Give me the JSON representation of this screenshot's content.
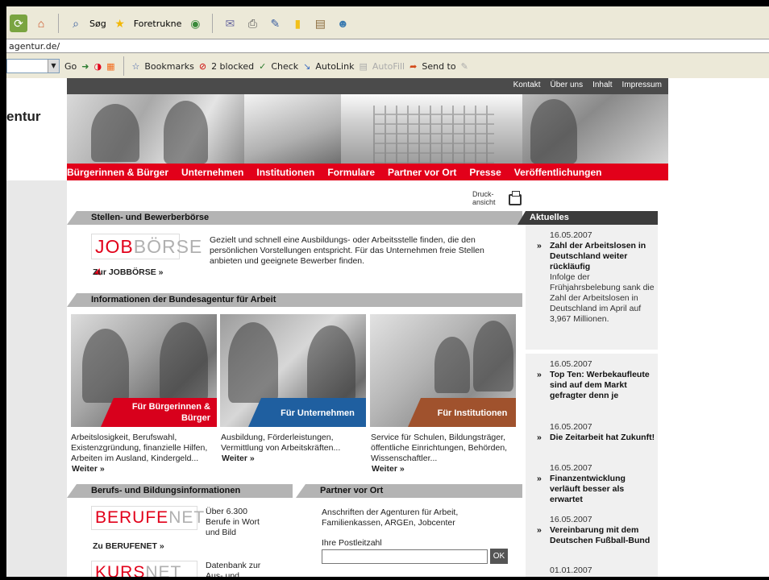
{
  "browser": {
    "toolbar": {
      "search_label": "Søg",
      "favorites_label": "Foretrukne"
    },
    "address": "agentur.de/",
    "google_bar": {
      "go_label": "Go",
      "bookmarks_label": "Bookmarks",
      "blocked_label": "2 blocked",
      "check_label": "Check",
      "autolink_label": "AutoLink",
      "autofill_label": "AutoFill",
      "sendto_label": "Send to"
    }
  },
  "page": {
    "brand_fragment": "entur",
    "topnav": [
      "Kontakt",
      "Über uns",
      "Inhalt",
      "Impressum"
    ],
    "mainnav": [
      "Bürgerinnen & Bürger",
      "Unternehmen",
      "Institutionen",
      "Formulare",
      "Partner vor Ort",
      "Presse",
      "Veröffentlichungen"
    ],
    "druck_line1": "Druck-",
    "druck_line2": "ansicht",
    "stellen": {
      "heading": "Stellen- und Bewerberbörse",
      "logo_red": "JOB",
      "logo_gray": "BÖRSE",
      "text": "Gezielt und schnell eine Ausbildungs- oder Arbeitsstelle finden, die den persönlichen Vorstellungen entspricht. Für das Unternehmen freie Stellen anbieten und geeignete Bewerber finden.",
      "link": "Zur JOBBÖRSE »"
    },
    "info": {
      "heading": "Informationen der Bundesagentur für Arbeit",
      "cards": [
        {
          "tag": "Für Bürgerinnen & Bürger",
          "text": "Arbeitslosigkeit, Berufswahl, Existenzgründung, finanzielle Hilfen, Arbeiten im Ausland, Kindergeld...",
          "link": "Weiter »"
        },
        {
          "tag": "Für Unternehmen",
          "text": "Ausbildung, Förderleistungen, Vermittlung von Arbeitskräften...",
          "link": "Weiter »"
        },
        {
          "tag": "Für Institutionen",
          "text": "Service für Schulen, Bildungsträger, öffentliche Einrichtungen, Behörden, Wissenschaftler...",
          "link": "Weiter »"
        }
      ]
    },
    "beruf": {
      "heading": "Berufs- und Bildungsinformationen",
      "berufenet_red": "BERUFE",
      "berufenet_gray": "NET",
      "berufenet_text": "Über 6.300 Berufe in Wort und Bild",
      "berufenet_link": "Zu BERUFENET »",
      "kursnet_red": "KURS",
      "kursnet_gray": "NET",
      "kursnet_text": "Datenbank zur Aus- und"
    },
    "partner": {
      "heading": "Partner vor Ort",
      "text": "Anschriften der Agenturen für Arbeit, Familienkassen, ARGEn, Jobcenter",
      "plz_label": "Ihre Postleitzahl",
      "ok_label": "OK"
    },
    "news": {
      "heading": "Aktuelles",
      "items": [
        {
          "date": "16.05.2007",
          "title": "Zahl der Arbeitslosen in Deutschland weiter rückläufig",
          "body": "Infolge der Frühjahrsbelebung sank die Zahl der Arbeitslosen in Deutschland im April auf 3,967 Millionen."
        },
        {
          "date": "16.05.2007",
          "title": "Top Ten: Werbekaufleute sind auf dem Markt gefragter denn je",
          "body": ""
        },
        {
          "date": "16.05.2007",
          "title": "Die Zeitarbeit hat Zukunft!",
          "body": ""
        },
        {
          "date": "16.05.2007",
          "title": "Finanzentwicklung verläuft besser als erwartet",
          "body": ""
        },
        {
          "date": "16.05.2007",
          "title": "Vereinbarung mit dem Deutschen Fußball-Bund",
          "body": ""
        },
        {
          "date": "01.01.2007",
          "title": "",
          "body": ""
        }
      ]
    },
    "colors": {
      "accent_red": "#e2001a",
      "blue_tag": "#1f5fa0",
      "brown_tag": "#a0522d"
    }
  }
}
